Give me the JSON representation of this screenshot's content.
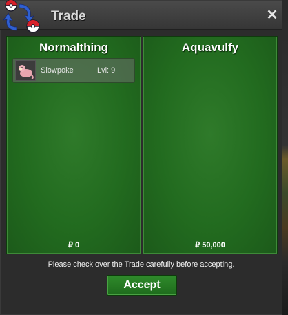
{
  "window": {
    "title": "Trade",
    "close_icon": "close-icon"
  },
  "left_panel": {
    "player_name": "Normalthing",
    "items": [
      {
        "name": "Slowpoke",
        "level": "Lvl: 9",
        "icon": "slowpoke-sprite-icon"
      }
    ],
    "money": "₽ 0"
  },
  "right_panel": {
    "player_name": "Aquavulfy",
    "items": [],
    "money": "₽ 50,000"
  },
  "footer": {
    "notice": "Please check over the Trade carefully before accepting.",
    "accept_label": "Accept"
  },
  "colors": {
    "panel_green": "#226b1f",
    "button_green": "#2f8a2b",
    "window_bg": "#2c2c2c",
    "titlebar": "#404040"
  }
}
